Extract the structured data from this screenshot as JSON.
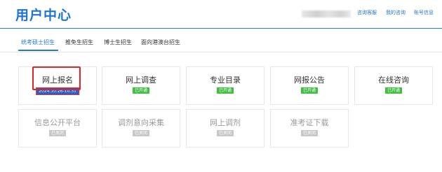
{
  "header": {
    "title": "用户中心",
    "links": [
      "咨询客服",
      "我的咨询",
      "账号信息"
    ]
  },
  "tabs": [
    "统考硕士招生",
    "推免生招生",
    "博士生招生",
    "面向港澳台招生"
  ],
  "active_tab_index": 0,
  "cards_row1": [
    {
      "label": "网上报名",
      "badge": "2024.10.26-10.31",
      "status": "selected"
    },
    {
      "label": "网上调查",
      "badge": "已开通",
      "status": "open"
    },
    {
      "label": "专业目录",
      "badge": "已开通",
      "status": "open"
    },
    {
      "label": "网报公告",
      "badge": "已开通",
      "status": "open"
    },
    {
      "label": "在线咨询",
      "badge": "已开通",
      "status": "open"
    }
  ],
  "cards_row2": [
    {
      "label": "信息公开平台",
      "badge": "已关闭",
      "status": "closed"
    },
    {
      "label": "调剂意向采集",
      "badge": "已关闭",
      "status": "closed"
    },
    {
      "label": "网上调剂",
      "badge": "已关闭",
      "status": "closed"
    },
    {
      "label": "准考证下载",
      "badge": "已关闭",
      "status": "closed"
    }
  ],
  "colors": {
    "accent": "#1e73d8",
    "open": "#3fbe3f",
    "closed": "#c8c8c8",
    "highlight": "#e32424"
  }
}
